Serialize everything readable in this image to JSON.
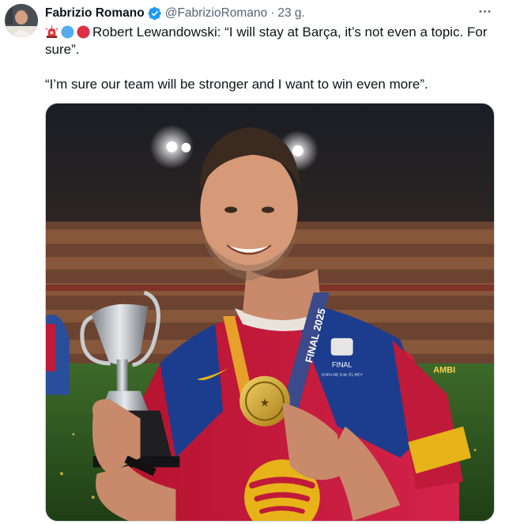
{
  "author": {
    "name": "Fabrizio Romano",
    "handle": "@FabrizioRomano",
    "separator": "·",
    "timestamp": "23 g."
  },
  "tweet": {
    "emojis": [
      "rotating-light-icon",
      "blue-circle-icon",
      "red-circle-icon"
    ],
    "line1": "Robert Lewandowski: “I will stay at Barça, it’s not even a topic. For sure”.",
    "line2": "“I’m sure our team will be stronger and I want to win even more”."
  },
  "media": {
    "medal_ribbon_text": "FINAL 2025",
    "shirt_badge_title": "FINAL",
    "shirt_badge_subtitle": "COPA DE S.M. EL REY",
    "sleeve_text": "AMBI"
  },
  "colors": {
    "verified_blue": "#1d9bf0",
    "secondary_text": "#536471",
    "barca_red": "#c8153a",
    "barca_blue": "#1c3d8e"
  }
}
